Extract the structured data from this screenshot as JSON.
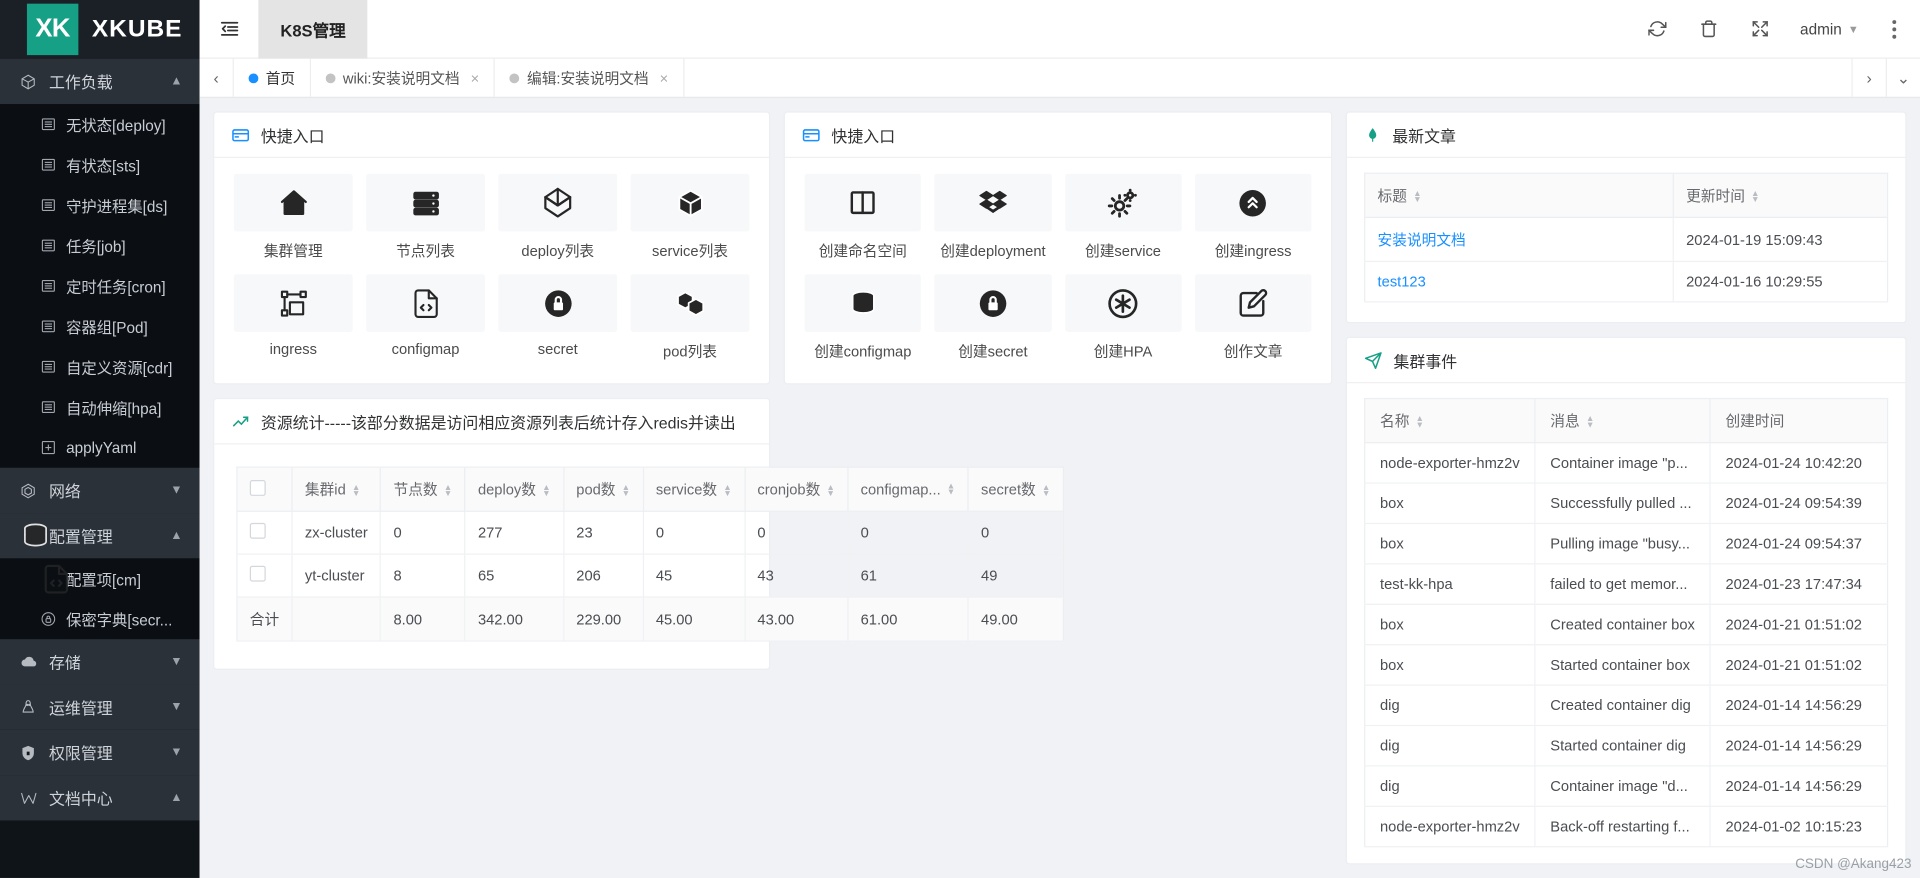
{
  "brand": {
    "badge": "XK",
    "name": "XKUBE"
  },
  "topbar": {
    "collapse_icon": "menu-fold-icon",
    "active_tab": "K8S管理",
    "icons": [
      "refresh-icon",
      "trash-icon",
      "fullscreen-icon"
    ],
    "user": "admin",
    "more_icon": "vertical-dots-icon"
  },
  "tabbar": {
    "prev_icon": "chevron-left-icon",
    "next_icon": "chevron-right-icon",
    "dropdown_icon": "chevron-down-icon",
    "tabs": [
      {
        "label": "首页",
        "active": true,
        "closable": false
      },
      {
        "label": "wiki:安装说明文档",
        "active": false,
        "closable": true
      },
      {
        "label": "编辑:安装说明文档",
        "active": false,
        "closable": true
      }
    ]
  },
  "sidebar": {
    "groups": [
      {
        "label": "工作负载",
        "icon": "cube-icon",
        "expanded": true,
        "arrow": "▲",
        "items": [
          {
            "label": "无状态[deploy]",
            "icon": "list-icon"
          },
          {
            "label": "有状态[sts]",
            "icon": "list-icon"
          },
          {
            "label": "守护进程集[ds]",
            "icon": "list-icon"
          },
          {
            "label": "任务[job]",
            "icon": "list-icon"
          },
          {
            "label": "定时任务[cron]",
            "icon": "list-icon"
          },
          {
            "label": "容器组[Pod]",
            "icon": "list-icon"
          },
          {
            "label": "自定义资源[cdr]",
            "icon": "list-icon"
          },
          {
            "label": "自动伸缩[hpa]",
            "icon": "list-icon"
          },
          {
            "label": "applyYaml",
            "icon": "plus-square-icon"
          }
        ]
      },
      {
        "label": "网络",
        "icon": "hexagon-icon",
        "expanded": false,
        "arrow": "▼",
        "items": []
      },
      {
        "label": "配置管理",
        "icon": "database-icon",
        "expanded": true,
        "arrow": "▲",
        "items": [
          {
            "label": "配置项[cm]",
            "icon": "file-code-icon"
          },
          {
            "label": "保密字典[secr...",
            "icon": "lock-icon"
          }
        ]
      },
      {
        "label": "存储",
        "icon": "cloud-icon",
        "expanded": false,
        "arrow": "▼",
        "items": []
      },
      {
        "label": "运维管理",
        "icon": "linux-icon",
        "expanded": false,
        "arrow": "▼",
        "items": []
      },
      {
        "label": "权限管理",
        "icon": "shield-lock-icon",
        "expanded": false,
        "arrow": "▼",
        "items": []
      },
      {
        "label": "文档中心",
        "icon": "w-icon",
        "expanded": true,
        "arrow": "▲",
        "items": []
      }
    ]
  },
  "shortcuts_1": {
    "title": "快捷入口",
    "icon": "card-icon",
    "tiles": [
      {
        "label": "集群管理",
        "icon": "home-icon"
      },
      {
        "label": "节点列表",
        "icon": "server-icon"
      },
      {
        "label": "deploy列表",
        "icon": "octahedron-icon"
      },
      {
        "label": "service列表",
        "icon": "box-icon"
      },
      {
        "label": "ingress",
        "icon": "vector-icon"
      },
      {
        "label": "configmap",
        "icon": "file-code-icon"
      },
      {
        "label": "secret",
        "icon": "lock-circle-icon"
      },
      {
        "label": "pod列表",
        "icon": "boxes-icon"
      }
    ]
  },
  "shortcuts_2": {
    "title": "快捷入口",
    "icon": "card-icon",
    "tiles": [
      {
        "label": "创建命名空间",
        "icon": "columns-icon"
      },
      {
        "label": "创建deployment",
        "icon": "dropbox-icon"
      },
      {
        "label": "创建service",
        "icon": "gears-icon"
      },
      {
        "label": "创建ingress",
        "icon": "ingress-circle-icon"
      },
      {
        "label": "创建configmap",
        "icon": "database-icon"
      },
      {
        "label": "创建secret",
        "icon": "lock-circle-icon"
      },
      {
        "label": "创建HPA",
        "icon": "asterisk-circle-icon"
      },
      {
        "label": "创作文章",
        "icon": "edit-square-icon"
      }
    ]
  },
  "stats": {
    "title": "资源统计-----该部分数据是访问相应资源列表后统计存入redis并读出",
    "icon": "chart-line-icon",
    "columns": [
      "集群id",
      "节点数",
      "deploy数",
      "pod数",
      "service数",
      "cronjob数",
      "configmap...",
      "secret数"
    ],
    "rows": [
      {
        "cluster": "zx-cluster",
        "values": [
          "0",
          "277",
          "23",
          "0",
          "0",
          "0",
          "0"
        ]
      },
      {
        "cluster": "yt-cluster",
        "values": [
          "8",
          "65",
          "206",
          "45",
          "43",
          "61",
          "49"
        ]
      }
    ],
    "summary_label": "合计",
    "summary_values": [
      "8.00",
      "342.00",
      "229.00",
      "45.00",
      "43.00",
      "61.00",
      "49.00"
    ]
  },
  "articles": {
    "title": "最新文章",
    "icon": "leaf-icon",
    "columns": [
      "标题",
      "更新时间"
    ],
    "rows": [
      {
        "title": "安装说明文档",
        "time": "2024-01-19 15:09:43"
      },
      {
        "title": "test123",
        "time": "2024-01-16 10:29:55"
      }
    ]
  },
  "events": {
    "title": "集群事件",
    "icon": "send-icon",
    "columns": [
      "名称",
      "消息",
      "创建时间"
    ],
    "rows": [
      {
        "name": "node-exporter-hmz2v",
        "message": "Container image \"p...",
        "time": "2024-01-24 10:42:20"
      },
      {
        "name": "box",
        "message": "Successfully pulled ...",
        "time": "2024-01-24 09:54:39"
      },
      {
        "name": "box",
        "message": "Pulling image \"busy...",
        "time": "2024-01-24 09:54:37"
      },
      {
        "name": "test-kk-hpa",
        "message": "failed to get memor...",
        "time": "2024-01-23 17:47:34"
      },
      {
        "name": "box",
        "message": "Created container box",
        "time": "2024-01-21 01:51:02"
      },
      {
        "name": "box",
        "message": "Started container box",
        "time": "2024-01-21 01:51:02"
      },
      {
        "name": "dig",
        "message": "Created container dig",
        "time": "2024-01-14 14:56:29"
      },
      {
        "name": "dig",
        "message": "Started container dig",
        "time": "2024-01-14 14:56:29"
      },
      {
        "name": "dig",
        "message": "Container image \"d...",
        "time": "2024-01-14 14:56:29"
      },
      {
        "name": "node-exporter-hmz2v",
        "message": "Back-off restarting f...",
        "time": "2024-01-02 10:15:23"
      }
    ]
  },
  "watermark": "CSDN @Akang423",
  "colors": {
    "accent": "#1890ff",
    "brand": "#16a085",
    "sidebar": "#0f1419"
  }
}
